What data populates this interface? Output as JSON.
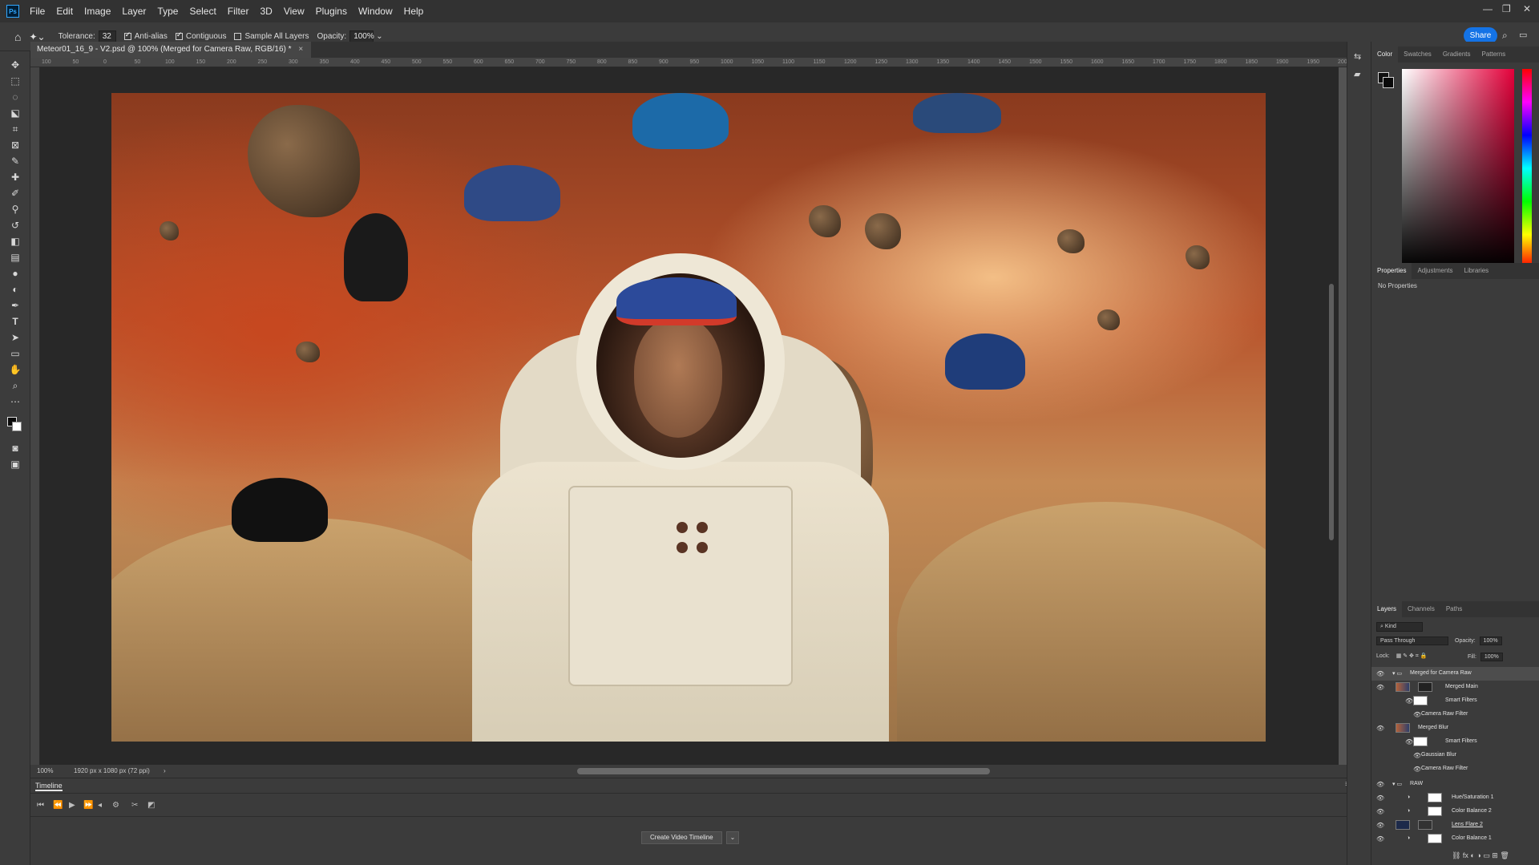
{
  "app": {
    "logo_text": "Ps",
    "menus": [
      "File",
      "Edit",
      "Image",
      "Layer",
      "Type",
      "Select",
      "Filter",
      "3D",
      "View",
      "Plugins",
      "Window",
      "Help"
    ],
    "window_controls": [
      "—",
      "❐",
      "✕"
    ]
  },
  "options_bar": {
    "tolerance_label": "Tolerance:",
    "tolerance_value": "32",
    "anti_alias_label": "Anti-alias",
    "contiguous_label": "Contiguous",
    "sample_all_layers_label": "Sample All Layers",
    "opacity_label": "Opacity:",
    "opacity_value": "100%",
    "share_label": "Share"
  },
  "document": {
    "tab_title": "Meteor01_16_9 - V2.psd @ 100% (Merged for Camera Raw, RGB/16) *",
    "tab_close": "×"
  },
  "ruler_ticks": [
    "100",
    "50",
    "0",
    "50",
    "100",
    "150",
    "200",
    "250",
    "300",
    "350",
    "400",
    "450",
    "500",
    "550",
    "600",
    "650",
    "700",
    "750",
    "800",
    "850",
    "900",
    "950",
    "1000",
    "1050",
    "1100",
    "1150",
    "1200",
    "1250",
    "1300",
    "1350",
    "1400",
    "1450",
    "1500",
    "1550",
    "1600",
    "1650",
    "1700",
    "1750",
    "1800",
    "1850",
    "1900",
    "1950",
    "2000"
  ],
  "status_bar": {
    "zoom": "100%",
    "doc_info": "1920 px x 1080 px (72 ppi)",
    "arrow": "›"
  },
  "timeline": {
    "title": "Timeline",
    "create_button": "Create Video Timeline",
    "menu_glyph": "⌄"
  },
  "color_panel": {
    "tabs": [
      "Color",
      "Swatches",
      "Gradients",
      "Patterns"
    ],
    "accent": "#e4003a"
  },
  "properties_panel": {
    "tabs": [
      "Properties",
      "Adjustments",
      "Libraries"
    ],
    "empty_text": "No Properties"
  },
  "layers_panel": {
    "tabs": [
      "Layers",
      "Channels",
      "Paths"
    ],
    "kind_filter": "Kind",
    "blend_mode": "Pass Through",
    "opacity_label": "Opacity:",
    "opacity_value": "100%",
    "lock_label": "Lock:",
    "fill_label": "Fill:",
    "fill_value": "100%",
    "layers": [
      {
        "name": "Merged for Camera Raw",
        "type": "group"
      },
      {
        "name": "Merged Main",
        "type": "smart"
      },
      {
        "name": "Smart Filters",
        "type": "filters"
      },
      {
        "name": "Camera Raw Filter",
        "type": "filter"
      },
      {
        "name": "Merged Blur",
        "type": "smart"
      },
      {
        "name": "Smart Filters",
        "type": "filters"
      },
      {
        "name": "Gaussian Blur",
        "type": "filter"
      },
      {
        "name": "Camera Raw Filter",
        "type": "filter"
      },
      {
        "name": "RAW",
        "type": "group"
      },
      {
        "name": "Hue/Saturation 1",
        "type": "adjustment"
      },
      {
        "name": "Color Balance 2",
        "type": "adjustment"
      },
      {
        "name": "Lens Flare 2",
        "type": "image"
      },
      {
        "name": "Color Balance 1",
        "type": "adjustment"
      }
    ]
  }
}
